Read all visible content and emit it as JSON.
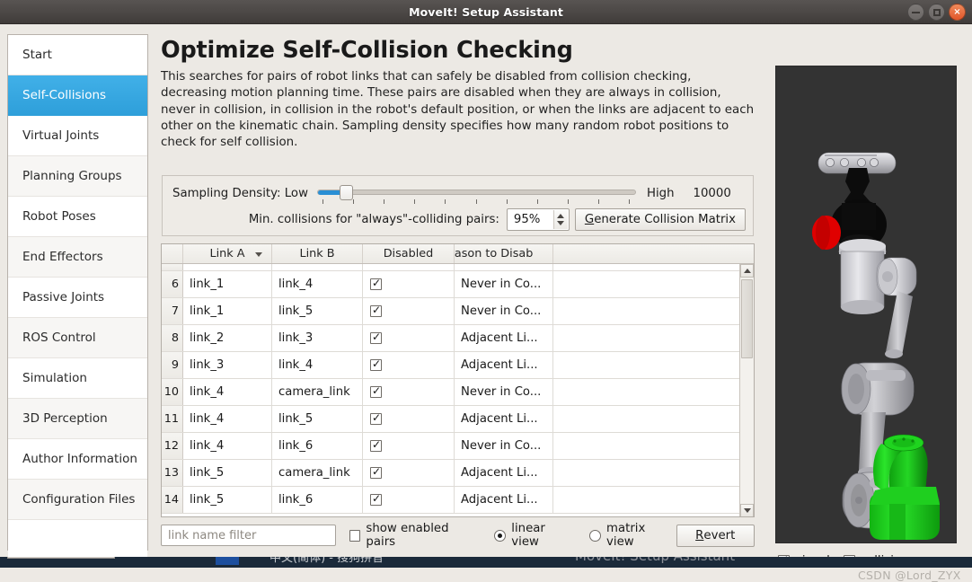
{
  "window": {
    "title": "MoveIt! Setup Assistant",
    "buttons": {
      "minimize": "minimize-icon",
      "maximize": "maximize-icon",
      "close": "×"
    }
  },
  "sidebar": {
    "items": [
      {
        "label": "Start",
        "selected": false
      },
      {
        "label": "Self-Collisions",
        "selected": true
      },
      {
        "label": "Virtual Joints",
        "selected": false
      },
      {
        "label": "Planning Groups",
        "selected": false
      },
      {
        "label": "Robot Poses",
        "selected": false
      },
      {
        "label": "End Effectors",
        "selected": false
      },
      {
        "label": "Passive Joints",
        "selected": false
      },
      {
        "label": "ROS Control",
        "selected": false
      },
      {
        "label": "Simulation",
        "selected": false
      },
      {
        "label": "3D Perception",
        "selected": false
      },
      {
        "label": "Author Information",
        "selected": false
      },
      {
        "label": "Configuration Files",
        "selected": false
      }
    ]
  },
  "main": {
    "title": "Optimize Self-Collision Checking",
    "description": "This searches for pairs of robot links that can safely be disabled from collision checking, decreasing motion planning time. These pairs are disabled when they are always in collision, never in collision, in collision in the robot's default position, or when the links are adjacent to each other on the kinematic chain. Sampling density specifies how many random robot positions to check for self collision."
  },
  "density": {
    "label": "Sampling Density: Low",
    "high_label": "High",
    "value": "10000",
    "slider_percent": 8,
    "min_collisions_label": "Min. collisions for \"always\"-colliding pairs:",
    "min_collisions_value": "95%",
    "generate_button": "Generate Collision Matrix",
    "generate_button_accel": "G"
  },
  "table": {
    "columns": [
      "Link A",
      "Link B",
      "Disabled",
      "eason to Disab"
    ],
    "sorted_column": "Link A",
    "rows": [
      {
        "num": "6",
        "link_a": "link_1",
        "link_b": "link_4",
        "disabled": true,
        "reason": "Never in Co..."
      },
      {
        "num": "7",
        "link_a": "link_1",
        "link_b": "link_5",
        "disabled": true,
        "reason": "Never in Co..."
      },
      {
        "num": "8",
        "link_a": "link_2",
        "link_b": "link_3",
        "disabled": true,
        "reason": "Adjacent Li..."
      },
      {
        "num": "9",
        "link_a": "link_3",
        "link_b": "link_4",
        "disabled": true,
        "reason": "Adjacent Li..."
      },
      {
        "num": "10",
        "link_a": "link_4",
        "link_b": "camera_link",
        "disabled": true,
        "reason": "Never in Co..."
      },
      {
        "num": "11",
        "link_a": "link_4",
        "link_b": "link_5",
        "disabled": true,
        "reason": "Adjacent Li..."
      },
      {
        "num": "12",
        "link_a": "link_4",
        "link_b": "link_6",
        "disabled": true,
        "reason": "Never in Co..."
      },
      {
        "num": "13",
        "link_a": "link_5",
        "link_b": "camera_link",
        "disabled": true,
        "reason": "Adjacent Li..."
      },
      {
        "num": "14",
        "link_a": "link_5",
        "link_b": "link_6",
        "disabled": true,
        "reason": "Adjacent Li..."
      }
    ]
  },
  "bottombar": {
    "filter_placeholder": "link name filter",
    "filter_value": "",
    "show_enabled_pairs": "show enabled pairs",
    "show_enabled_checked": false,
    "linear_view": "linear view",
    "linear_selected": true,
    "matrix_view": "matrix view",
    "matrix_selected": false,
    "revert_button": "Revert",
    "revert_accel": "R"
  },
  "view3d": {
    "visual_label": "visual",
    "visual_checked": true,
    "collision_label": "collision",
    "collision_checked": false,
    "background": "#333333"
  },
  "watermark": "CSDN @Lord_ZYX",
  "taskbar": {
    "app_text": "MoveIt! Setup Assistant",
    "ime_text": "中文(简体) - 搜狗拼音"
  },
  "colors": {
    "accent": "#2e9fda",
    "window_titlebar": "#4a4644",
    "close_button": "#e2562a",
    "panel_bg": "#ece9e4"
  }
}
